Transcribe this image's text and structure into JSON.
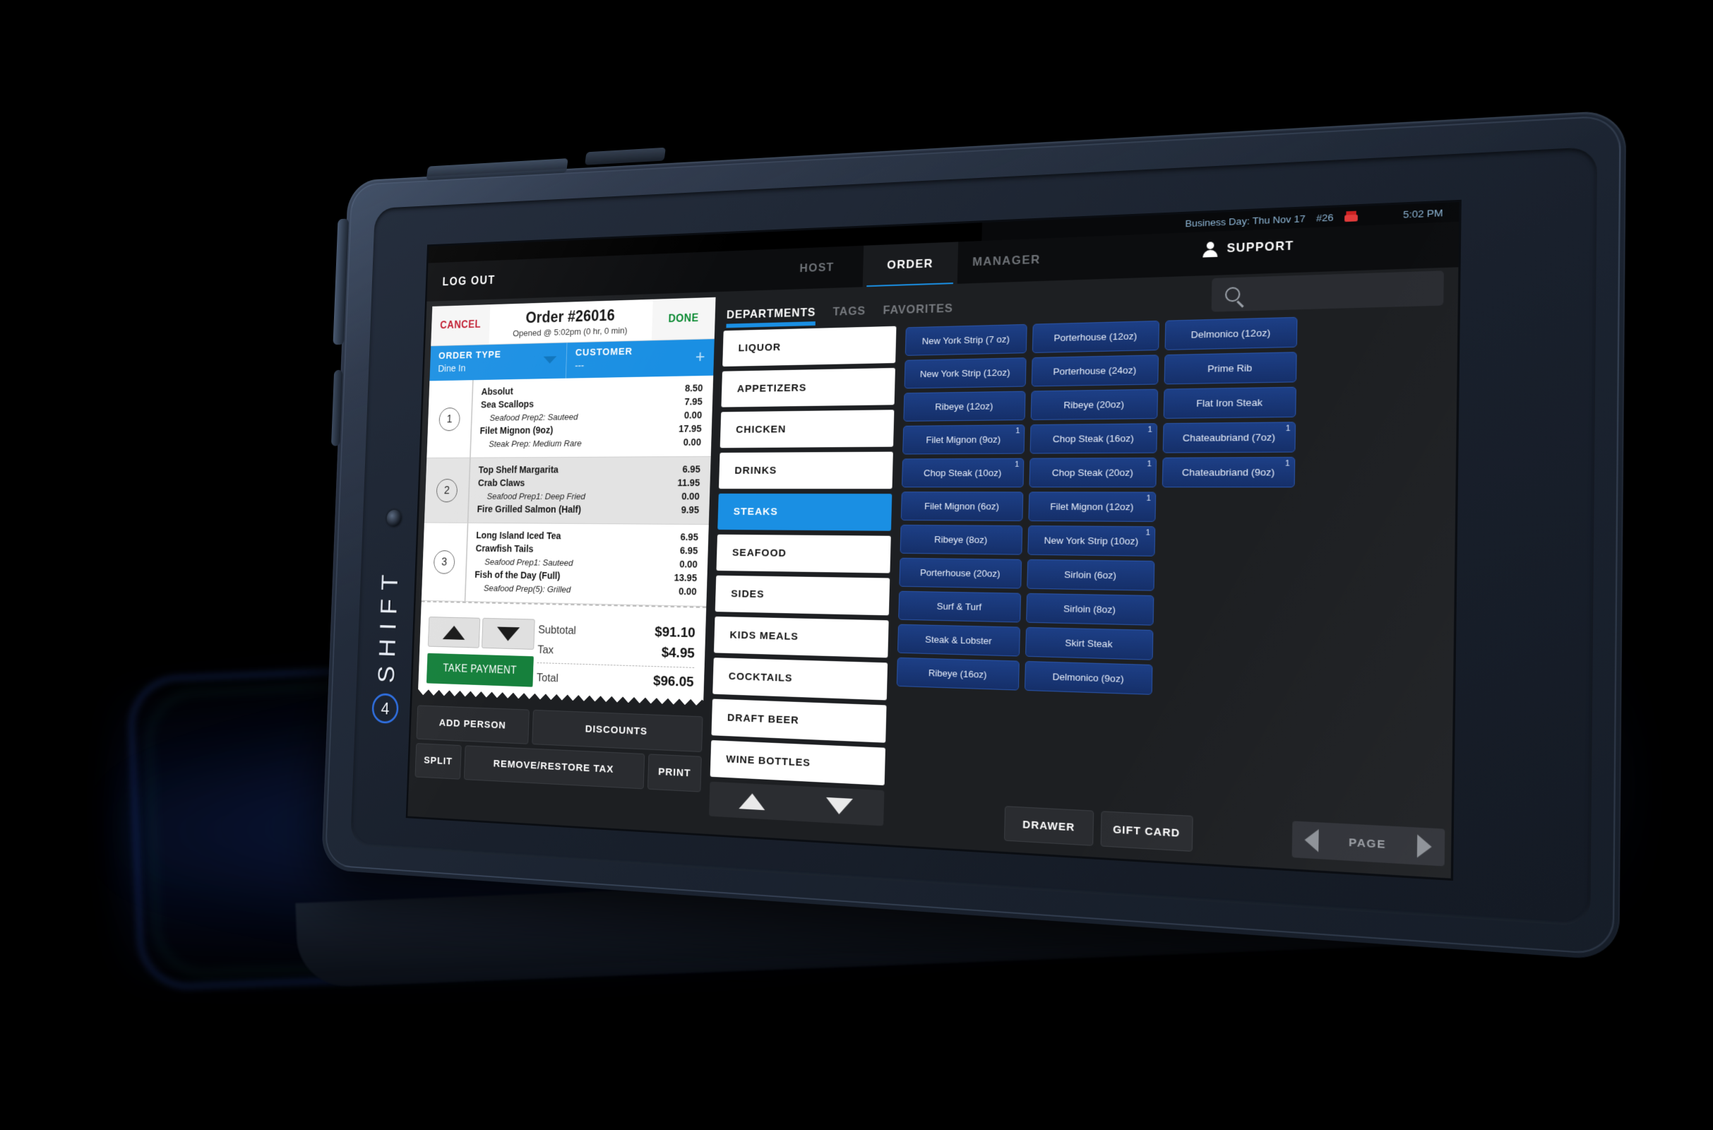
{
  "device": {
    "brand": "SHIFT",
    "brand_mark": "4"
  },
  "statusbar": {
    "business_day": "Business Day: Thu Nov 17",
    "order_count": "#26",
    "printer_icon": "printer-icon",
    "time": "5:02 PM"
  },
  "nav": {
    "logout": "LOG OUT",
    "tabs": [
      {
        "label": "HOST",
        "active": false
      },
      {
        "label": "ORDER",
        "active": true
      },
      {
        "label": "MANAGER",
        "active": false
      }
    ],
    "support": "SUPPORT",
    "support_icon": "support-person-icon"
  },
  "ticket": {
    "cancel": "CANCEL",
    "title": "Order #26016",
    "subtitle": "Opened @ 5:02pm (0 hr, 0 min)",
    "done": "DONE",
    "order_type_label": "ORDER TYPE",
    "order_type_value": "Dine In",
    "customer_label": "CUSTOMER",
    "customer_value": "---",
    "seats": [
      {
        "number": "1",
        "highlighted": false,
        "items": [
          {
            "name": "Absolut",
            "price": "8.50",
            "modifier": false
          },
          {
            "name": "Sea Scallops",
            "price": "7.95",
            "modifier": false
          },
          {
            "name": "Seafood Prep2: Sauteed",
            "price": "0.00",
            "modifier": true
          },
          {
            "name": "Filet Mignon (9oz)",
            "price": "17.95",
            "modifier": false
          },
          {
            "name": "Steak Prep: Medium Rare",
            "price": "0.00",
            "modifier": true
          }
        ]
      },
      {
        "number": "2",
        "highlighted": true,
        "items": [
          {
            "name": "Top Shelf Margarita",
            "price": "6.95",
            "modifier": false
          },
          {
            "name": "Crab Claws",
            "price": "11.95",
            "modifier": false
          },
          {
            "name": "Seafood Prep1: Deep Fried",
            "price": "0.00",
            "modifier": true
          },
          {
            "name": "Fire Grilled Salmon (Half)",
            "price": "9.95",
            "modifier": false
          }
        ]
      },
      {
        "number": "3",
        "highlighted": false,
        "items": [
          {
            "name": "Long Island Iced Tea",
            "price": "6.95",
            "modifier": false
          },
          {
            "name": "Crawfish Tails",
            "price": "6.95",
            "modifier": false
          },
          {
            "name": "Seafood Prep1: Sauteed",
            "price": "0.00",
            "modifier": true
          },
          {
            "name": "Fish of the Day (Full)",
            "price": "13.95",
            "modifier": false
          },
          {
            "name": "Seafood Prep(5): Grilled",
            "price": "0.00",
            "modifier": true
          }
        ]
      }
    ],
    "totals": [
      {
        "label": "Subtotal",
        "value": "$91.10"
      },
      {
        "label": "Tax",
        "value": "$4.95"
      },
      {
        "label": "Total",
        "value": "$96.05"
      }
    ],
    "take_payment": "TAKE PAYMENT",
    "scroll_up_icon": "triangle-up-icon",
    "scroll_down_icon": "triangle-down-icon"
  },
  "order_buttons": {
    "row1": [
      "ADD PERSON",
      "DISCOUNTS"
    ],
    "row2": [
      "SPLIT",
      "REMOVE/RESTORE TAX",
      "PRINT"
    ]
  },
  "catalog": {
    "tabs": [
      {
        "label": "DEPARTMENTS",
        "active": true
      },
      {
        "label": "TAGS",
        "active": false
      },
      {
        "label": "FAVORITES",
        "active": false
      }
    ],
    "search_icon": "search-icon",
    "search_value": "",
    "departments": [
      {
        "label": "LIQUOR",
        "active": false
      },
      {
        "label": "APPETIZERS",
        "active": false
      },
      {
        "label": "CHICKEN",
        "active": false
      },
      {
        "label": "DRINKS",
        "active": false
      },
      {
        "label": "STEAKS",
        "active": true
      },
      {
        "label": "SEAFOOD",
        "active": false
      },
      {
        "label": "SIDES",
        "active": false
      },
      {
        "label": "KIDS MEALS",
        "active": false
      },
      {
        "label": "COCKTAILS",
        "active": false
      },
      {
        "label": "DRAFT BEER",
        "active": false
      },
      {
        "label": "WINE BOTTLES",
        "active": false
      }
    ],
    "dept_scroll_up_icon": "triangle-up-icon",
    "dept_scroll_down_icon": "triangle-down-icon",
    "items": [
      {
        "label": "New York Strip (7 oz)",
        "qty": ""
      },
      {
        "label": "Porterhouse (12oz)",
        "qty": ""
      },
      {
        "label": "Delmonico (12oz)",
        "qty": ""
      },
      {
        "label": "New York Strip (12oz)",
        "qty": ""
      },
      {
        "label": "Porterhouse (24oz)",
        "qty": ""
      },
      {
        "label": "Prime Rib",
        "qty": ""
      },
      {
        "label": "Ribeye (12oz)",
        "qty": ""
      },
      {
        "label": "Ribeye (20oz)",
        "qty": ""
      },
      {
        "label": "Flat Iron Steak",
        "qty": ""
      },
      {
        "label": "Filet Mignon (9oz)",
        "qty": "1"
      },
      {
        "label": "Chop Steak (16oz)",
        "qty": "1"
      },
      {
        "label": "Chateaubriand (7oz)",
        "qty": "1"
      },
      {
        "label": "Chop Steak (10oz)",
        "qty": "1"
      },
      {
        "label": "Chop Steak (20oz)",
        "qty": "1"
      },
      {
        "label": "Chateaubriand (9oz)",
        "qty": "1"
      },
      {
        "label": "Filet Mignon (6oz)",
        "qty": ""
      },
      {
        "label": "Filet Mignon (12oz)",
        "qty": "1"
      },
      {
        "label": "",
        "qty": ""
      },
      {
        "label": "Ribeye (8oz)",
        "qty": ""
      },
      {
        "label": "New York Strip (10oz)",
        "qty": "1"
      },
      {
        "label": "",
        "qty": ""
      },
      {
        "label": "Porterhouse (20oz)",
        "qty": ""
      },
      {
        "label": "Sirloin (6oz)",
        "qty": ""
      },
      {
        "label": "",
        "qty": ""
      },
      {
        "label": "Surf & Turf",
        "qty": ""
      },
      {
        "label": "Sirloin (8oz)",
        "qty": ""
      },
      {
        "label": "",
        "qty": ""
      },
      {
        "label": "Steak & Lobster",
        "qty": ""
      },
      {
        "label": "Skirt Steak",
        "qty": ""
      },
      {
        "label": "",
        "qty": ""
      },
      {
        "label": "Ribeye (16oz)",
        "qty": ""
      },
      {
        "label": "Delmonico (9oz)",
        "qty": ""
      },
      {
        "label": "",
        "qty": ""
      }
    ],
    "bottom_buttons": [
      "DRAWER",
      "GIFT CARD"
    ],
    "pager_label": "PAGE",
    "pager_prev_icon": "caret-left-icon",
    "pager_next_icon": "caret-right-icon"
  },
  "colors": {
    "accent_blue": "#1a8fe3",
    "item_blue": "#1d3f86",
    "green": "#16803c",
    "red": "#c0182c"
  }
}
